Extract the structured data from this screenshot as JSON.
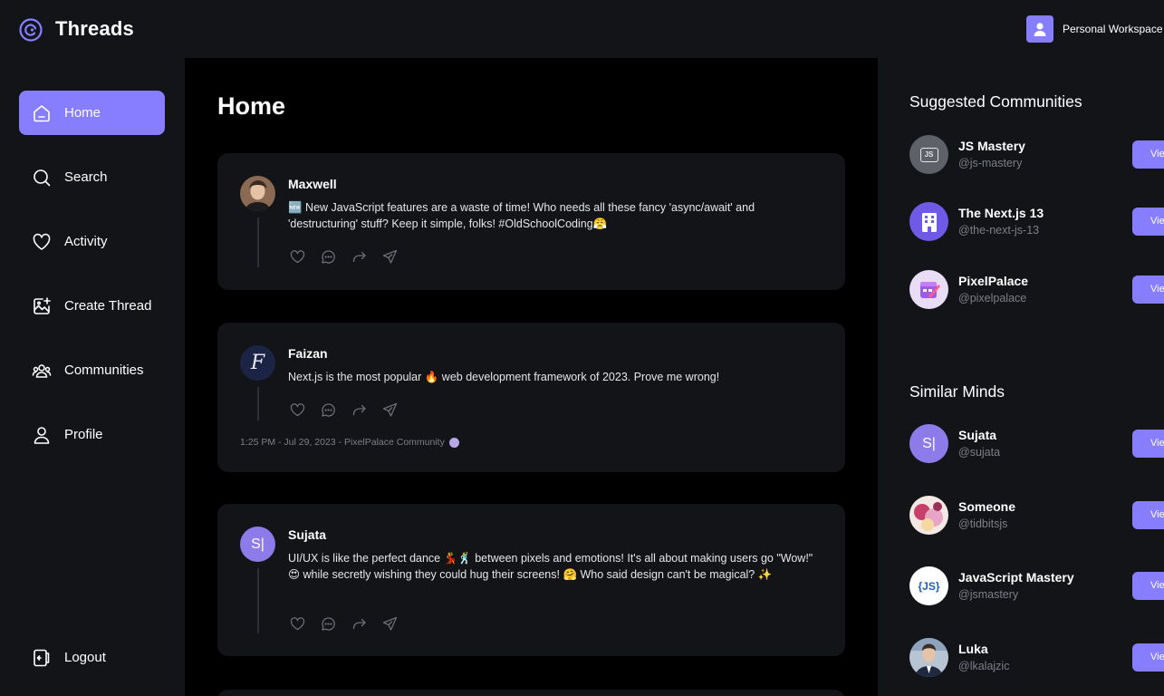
{
  "app": {
    "title": "Threads",
    "workspace_label": "Personal Workspace"
  },
  "nav": {
    "items": [
      {
        "label": "Home",
        "icon": "home-icon"
      },
      {
        "label": "Search",
        "icon": "search-icon"
      },
      {
        "label": "Activity",
        "icon": "heart-icon"
      },
      {
        "label": "Create Thread",
        "icon": "create-thread-icon"
      },
      {
        "label": "Communities",
        "icon": "communities-icon"
      },
      {
        "label": "Profile",
        "icon": "user-icon"
      }
    ],
    "logout_label": "Logout"
  },
  "main": {
    "title": "Home",
    "threads": [
      {
        "author": "Maxwell",
        "content": "🆕 New JavaScript features are a waste of time! Who needs all these fancy 'async/await' and 'destructuring' stuff? Keep it simple, folks! #OldSchoolCoding😤",
        "meta": ""
      },
      {
        "author": "Faizan",
        "avatar_letter": "F",
        "content": "Next.js is the most popular 🔥 web development framework of 2023. Prove me wrong!",
        "meta": "1:25 PM - Jul 29, 2023 - PixelPalace Community"
      },
      {
        "author": "Sujata",
        "avatar_letter": "S|",
        "content": "UI/UX is like the perfect dance 💃🕺 between pixels and emotions! It's all about making users go \"Wow!\" 😍 while secretly wishing they could hug their screens! 🤗 Who said design can't be magical? ✨",
        "meta": ""
      }
    ]
  },
  "right": {
    "suggested_title": "Suggested Communities",
    "suggested": [
      {
        "name": "JS Mastery",
        "handle": "@js-mastery",
        "button": "View"
      },
      {
        "name": "The Next.js 13",
        "handle": "@the-next-js-13",
        "button": "View"
      },
      {
        "name": "PixelPalace",
        "handle": "@pixelpalace",
        "button": "View"
      }
    ],
    "similar_title": "Similar Minds",
    "similar": [
      {
        "name": "Sujata",
        "handle": "@sujata",
        "button": "View",
        "avatar_letter": "S|"
      },
      {
        "name": "Someone",
        "handle": "@tidbitsjs",
        "button": "View"
      },
      {
        "name": "JavaScript Mastery",
        "handle": "@jsmastery",
        "button": "View",
        "avatar_text": "{JS}"
      },
      {
        "name": "Luka",
        "handle": "@lkalajzic",
        "button": "View"
      }
    ]
  },
  "colors": {
    "accent": "#877eff",
    "background": "#121417",
    "feed": "#000000",
    "muted": "#7d7f88"
  }
}
